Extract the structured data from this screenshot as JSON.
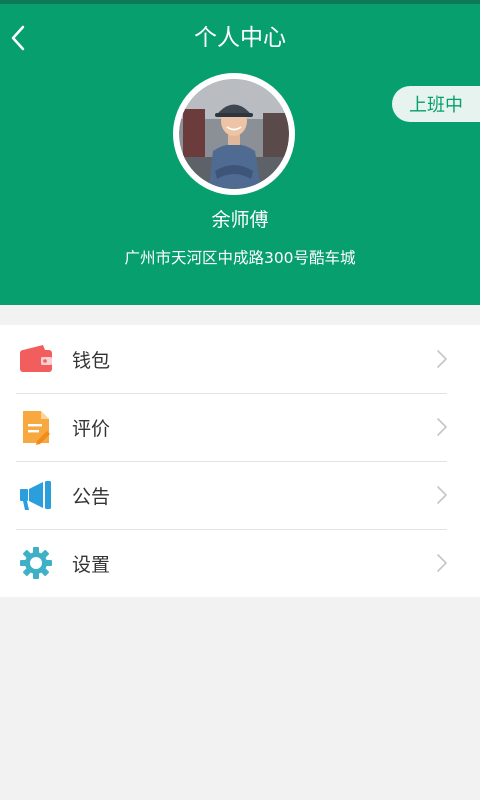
{
  "header": {
    "title": "个人中心",
    "status_label": "上班中",
    "user_name": "余师傅",
    "address": "广州市天河区中成路300号酷车城"
  },
  "menu": {
    "items": [
      {
        "label": "钱包",
        "icon": "wallet-icon"
      },
      {
        "label": "评价",
        "icon": "document-icon"
      },
      {
        "label": "公告",
        "icon": "megaphone-icon"
      },
      {
        "label": "设置",
        "icon": "gear-icon"
      }
    ]
  },
  "colors": {
    "primary": "#079f6e",
    "wallet": "#f25d5d",
    "review": "#f7a93f",
    "notice": "#2a9fdc",
    "settings": "#3fb1c7"
  }
}
